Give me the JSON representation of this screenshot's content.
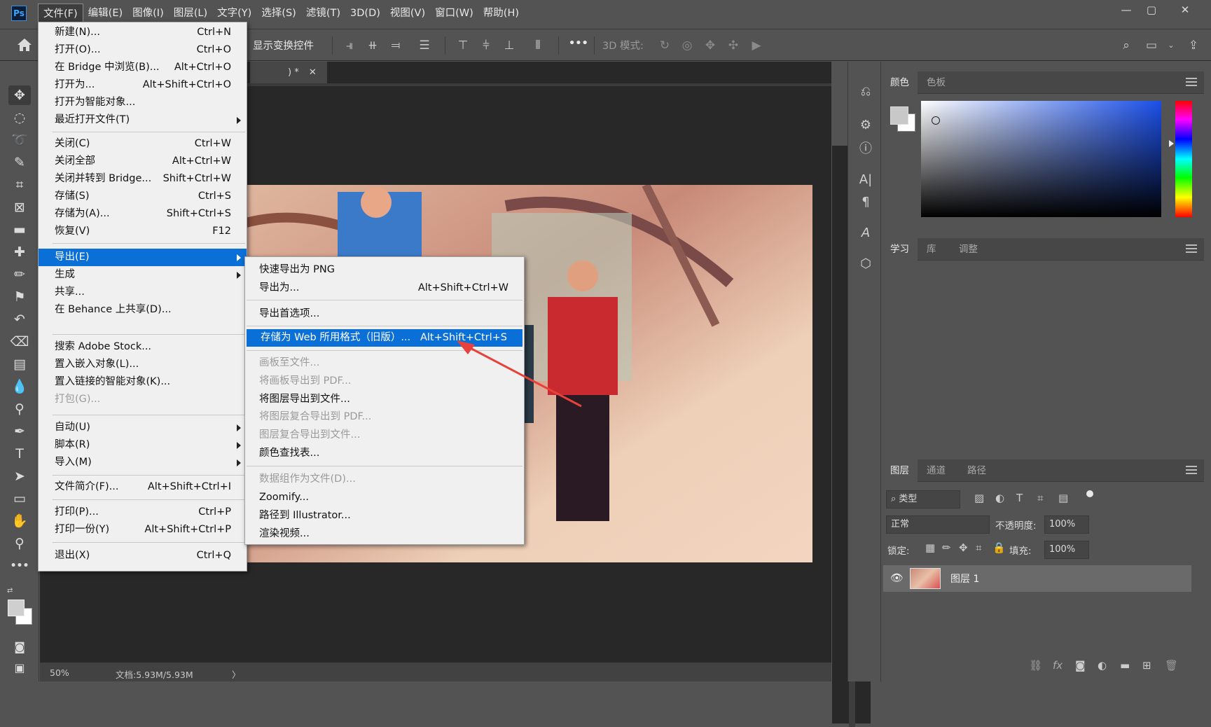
{
  "menubar": {
    "logo": "Ps",
    "items": [
      "文件(F)",
      "编辑(E)",
      "图像(I)",
      "图层(L)",
      "文字(Y)",
      "选择(S)",
      "滤镜(T)",
      "3D(D)",
      "视图(V)",
      "窗口(W)",
      "帮助(H)"
    ],
    "window_controls": [
      "—",
      "▢",
      "✕"
    ]
  },
  "options": {
    "show_transform": "显示变换控件",
    "mode_3d": "3D 模式:",
    "more": "•••"
  },
  "document": {
    "tab_suffix": ") *",
    "tab_close": "✕"
  },
  "status": {
    "zoom": "50%",
    "doc_size": "文档:5.93M/5.93M",
    "arrow": "〉"
  },
  "file_menu": [
    {
      "label": "新建(N)...",
      "shortcut": "Ctrl+N"
    },
    {
      "label": "打开(O)...",
      "shortcut": "Ctrl+O"
    },
    {
      "label": "在 Bridge 中浏览(B)...",
      "shortcut": "Alt+Ctrl+O"
    },
    {
      "label": "打开为...",
      "shortcut": "Alt+Shift+Ctrl+O"
    },
    {
      "label": "打开为智能对象...",
      "shortcut": ""
    },
    {
      "label": "最近打开文件(T)",
      "shortcut": "",
      "submenu": true
    },
    {
      "label": "关闭(C)",
      "shortcut": "Ctrl+W"
    },
    {
      "label": "关闭全部",
      "shortcut": "Alt+Ctrl+W"
    },
    {
      "label": "关闭并转到 Bridge...",
      "shortcut": "Shift+Ctrl+W"
    },
    {
      "label": "存储(S)",
      "shortcut": "Ctrl+S"
    },
    {
      "label": "存储为(A)...",
      "shortcut": "Shift+Ctrl+S"
    },
    {
      "label": "恢复(V)",
      "shortcut": "F12"
    },
    {
      "label": "导出(E)",
      "shortcut": "",
      "submenu": true,
      "highlighted": true
    },
    {
      "label": "生成",
      "shortcut": "",
      "submenu": true
    },
    {
      "label": "共享...",
      "shortcut": ""
    },
    {
      "label": "在 Behance 上共享(D)...",
      "shortcut": ""
    },
    {
      "label": "搜索 Adobe Stock...",
      "shortcut": ""
    },
    {
      "label": "置入嵌入对象(L)...",
      "shortcut": ""
    },
    {
      "label": "置入链接的智能对象(K)...",
      "shortcut": ""
    },
    {
      "label": "打包(G)...",
      "shortcut": "",
      "disabled": true
    },
    {
      "label": "自动(U)",
      "shortcut": "",
      "submenu": true
    },
    {
      "label": "脚本(R)",
      "shortcut": "",
      "submenu": true
    },
    {
      "label": "导入(M)",
      "shortcut": "",
      "submenu": true
    },
    {
      "label": "文件简介(F)...",
      "shortcut": "Alt+Shift+Ctrl+I"
    },
    {
      "label": "打印(P)...",
      "shortcut": "Ctrl+P"
    },
    {
      "label": "打印一份(Y)",
      "shortcut": "Alt+Shift+Ctrl+P"
    },
    {
      "label": "退出(X)",
      "shortcut": "Ctrl+Q"
    }
  ],
  "export_menu": [
    {
      "label": "快速导出为 PNG",
      "shortcut": ""
    },
    {
      "label": "导出为...",
      "shortcut": "Alt+Shift+Ctrl+W"
    },
    {
      "label": "导出首选项...",
      "shortcut": ""
    },
    {
      "label": "存储为 Web 所用格式（旧版）...",
      "shortcut": "Alt+Shift+Ctrl+S",
      "highlighted": true
    },
    {
      "label": "画板至文件...",
      "shortcut": "",
      "disabled": true
    },
    {
      "label": "将画板导出到 PDF...",
      "shortcut": "",
      "disabled": true
    },
    {
      "label": "将图层导出到文件...",
      "shortcut": ""
    },
    {
      "label": "将图层复合导出到 PDF...",
      "shortcut": "",
      "disabled": true
    },
    {
      "label": "图层复合导出到文件...",
      "shortcut": "",
      "disabled": true
    },
    {
      "label": "颜色查找表...",
      "shortcut": ""
    },
    {
      "label": "数据组作为文件(D)...",
      "shortcut": "",
      "disabled": true
    },
    {
      "label": "Zoomify...",
      "shortcut": ""
    },
    {
      "label": "路径到 Illustrator...",
      "shortcut": ""
    },
    {
      "label": "渲染视频...",
      "shortcut": ""
    }
  ],
  "color_panel": {
    "tabs": [
      "颜色",
      "色板"
    ]
  },
  "learn_panel": {
    "tabs": [
      "学习",
      "库",
      "调整"
    ]
  },
  "layers_panel": {
    "tabs": [
      "图层",
      "通道",
      "路径"
    ],
    "filter_kind": "类型",
    "blend_mode": "正常",
    "opacity_label": "不透明度:",
    "opacity_value": "100%",
    "lock_label": "锁定:",
    "fill_label": "填充:",
    "fill_value": "100%",
    "layer_name": "图层 1",
    "footer_fx": "fx"
  },
  "colors": {
    "accent": "#0a6fd6",
    "annotation_arrow": "#e8403a"
  }
}
